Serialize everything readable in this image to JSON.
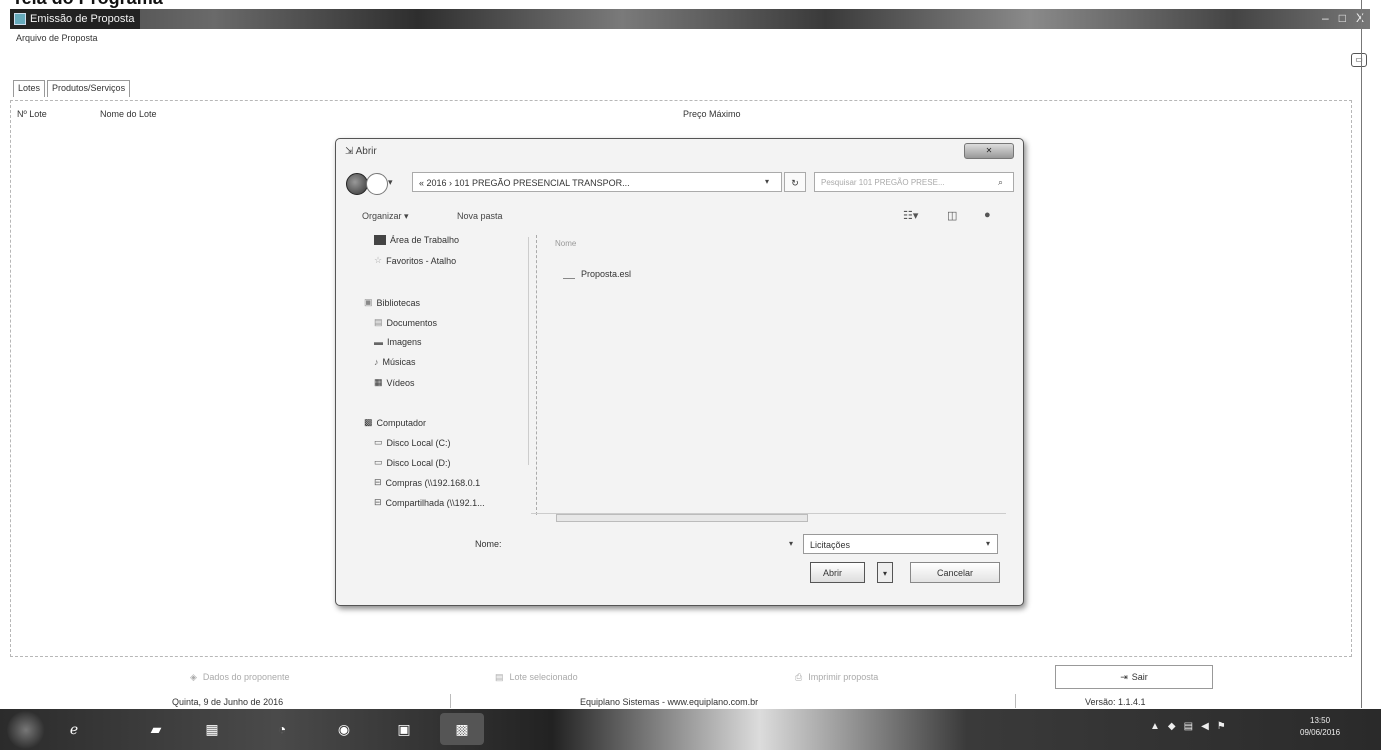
{
  "doc_heading": "Tela do Programa",
  "window": {
    "title": "Emissão de Proposta",
    "controls": {
      "minimize": "–",
      "maximize": "□",
      "close": "X"
    }
  },
  "menu": {
    "file": "Arquivo de Proposta"
  },
  "tabs": [
    {
      "label": "Lotes",
      "active": true
    },
    {
      "label": "Produtos/Serviços",
      "active": false
    }
  ],
  "table_columns": [
    "Nº Lote",
    "Nome do Lote",
    "Preço Máximo"
  ],
  "dialog": {
    "title": "Abrir",
    "close_label": "✕",
    "address": "« 2016 › 101 PREGÃO PRESENCIAL TRANSPOR...",
    "search_placeholder": "Pesquisar 101 PREGÃO PRESE...",
    "organize": "Organizar ▾",
    "new_folder": "Nova pasta",
    "nav_items": [
      {
        "label": "Área de Trabalho",
        "icon": "desktop-icon"
      },
      {
        "label": "Favoritos - Atalho",
        "icon": "star-icon"
      },
      {
        "label": "Bibliotecas",
        "icon": "library-icon"
      },
      {
        "label": "Documentos",
        "icon": "document-icon"
      },
      {
        "label": "Imagens",
        "icon": "image-icon"
      },
      {
        "label": "Músicas",
        "icon": "music-icon"
      },
      {
        "label": "Vídeos",
        "icon": "video-icon"
      },
      {
        "label": "Computador",
        "icon": "computer-icon"
      },
      {
        "label": "Disco Local (C:)",
        "icon": "drive-icon"
      },
      {
        "label": "Disco Local (D:)",
        "icon": "drive-icon"
      },
      {
        "label": "Compras (\\\\192.168.0.1",
        "icon": "network-drive-icon"
      },
      {
        "label": "Compartilhada (\\\\192.1...",
        "icon": "network-drive-icon"
      }
    ],
    "column_name": "Nome",
    "files": [
      {
        "name": "Proposta.esl"
      }
    ],
    "file_name_label": "Nome:",
    "file_name_value": "",
    "filter_value": "Licitações",
    "open_button": "Abrir",
    "cancel_button": "Cancelar"
  },
  "bottom_buttons": {
    "dados": "Dados do proponente",
    "lote": "Lote selecionado",
    "imprimir": "Imprimir proposta",
    "sair": "Sair"
  },
  "status": {
    "date": "Quinta, 9 de Junho de 2016",
    "company": "Equiplano Sistemas - www.equiplano.com.br",
    "version": "Versão: 1.1.4.1"
  },
  "taskbar": {
    "clock_time": "13:50",
    "clock_date": "09/06/2016"
  }
}
